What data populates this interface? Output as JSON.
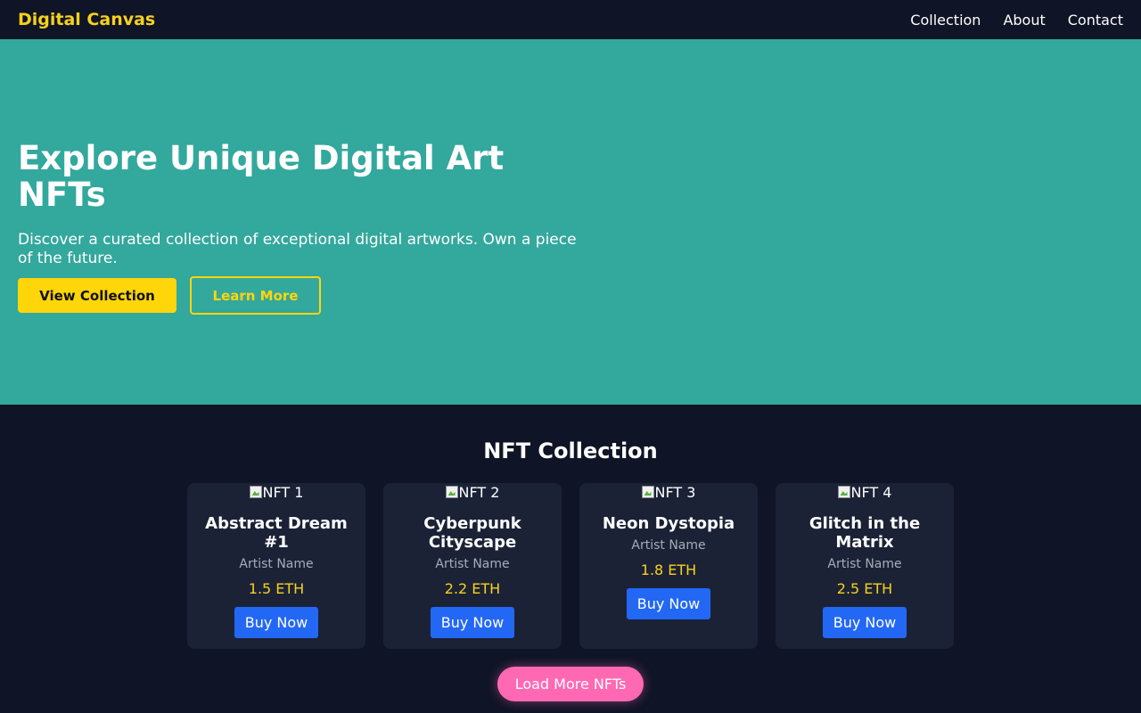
{
  "header": {
    "brand": "Digital Canvas",
    "nav": [
      "Collection",
      "About",
      "Contact"
    ]
  },
  "hero": {
    "title": "Explore Unique Digital Art NFTs",
    "subtitle": "Discover a curated collection of exceptional digital artworks. Own a piece of the future.",
    "primary_button": "View Collection",
    "secondary_button": "Learn More"
  },
  "collection": {
    "title": "NFT Collection",
    "items": [
      {
        "img_alt": "NFT 1",
        "title": "Abstract Dream #1",
        "artist": "Artist Name",
        "price": "1.5 ETH",
        "button": "Buy Now"
      },
      {
        "img_alt": "NFT 2",
        "title": "Cyberpunk Cityscape",
        "artist": "Artist Name",
        "price": "2.2 ETH",
        "button": "Buy Now"
      },
      {
        "img_alt": "NFT 3",
        "title": "Neon Dystopia",
        "artist": "Artist Name",
        "price": "1.8 ETH",
        "button": "Buy Now"
      },
      {
        "img_alt": "NFT 4",
        "title": "Glitch in the Matrix",
        "artist": "Artist Name",
        "price": "2.5 ETH",
        "button": "Buy Now"
      }
    ],
    "load_more": "Load More NFTs"
  },
  "colors": {
    "background": "#0f1426",
    "hero": "#33a89d",
    "accent_yellow": "#ffd60a",
    "buy_button": "#2368f5",
    "load_more": "#ff69b4"
  }
}
